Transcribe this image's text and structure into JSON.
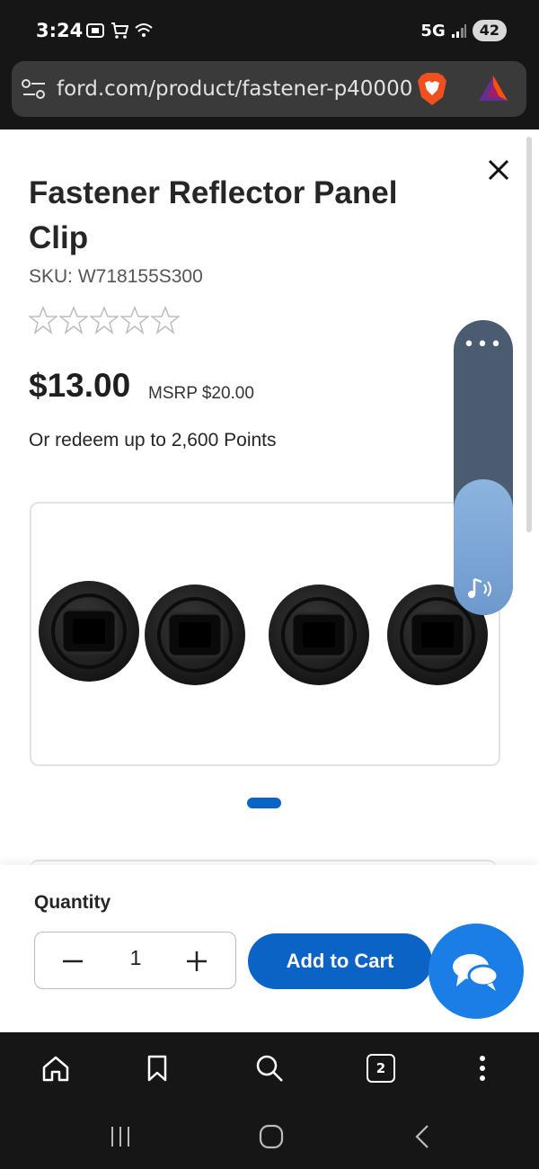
{
  "status_bar": {
    "time": "3:24",
    "network": "5G",
    "battery": "42"
  },
  "browser": {
    "url": "ford.com/product/fastener-p40000",
    "tabs_count": "2"
  },
  "product": {
    "title": "Fastener Reflector Panel Clip",
    "sku": "SKU: W718155S300",
    "rating_stars": 0,
    "price": "$13.00",
    "msrp": "MSRP $20.00",
    "points": "Or redeem up to 2,600 Points",
    "images_total": 1,
    "images_current": 1
  },
  "purchase": {
    "quantity_label": "Quantity",
    "quantity_value": "1",
    "add_to_cart_label": "Add to Cart"
  },
  "media_widget": {
    "menu_glyph": "•••",
    "volume_level": 0.46
  },
  "colors": {
    "accent": "#0b63c5",
    "chat": "#1a7ee6",
    "system_bar": "#161616"
  }
}
